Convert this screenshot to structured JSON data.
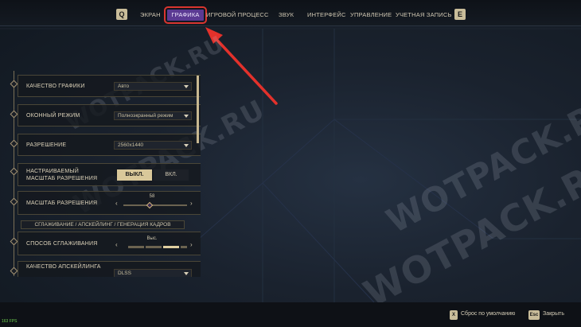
{
  "nav": {
    "left_key": "Q",
    "right_key": "E",
    "tabs": [
      {
        "label": "ЭКРАН"
      },
      {
        "label": "ГРАФИКА"
      },
      {
        "label": "ИГРОВОЙ ПРОЦЕСС"
      },
      {
        "label": "ЗВУК"
      },
      {
        "label": "ИНТЕРФЕЙС"
      },
      {
        "label": "УПРАВЛЕНИЕ"
      },
      {
        "label": "УЧЕТНАЯ ЗАПИСЬ"
      }
    ],
    "active_tab": "ГРАФИКА"
  },
  "settings": {
    "graphics_quality": {
      "label": "КАЧЕСТВО ГРАФИКИ",
      "value": "Авто"
    },
    "window_mode": {
      "label": "ОКОННЫЙ РЕЖИМ",
      "value": "Полноэкранный режим"
    },
    "resolution": {
      "label": "РАЗРЕШЕНИЕ",
      "value": "2560x1440"
    },
    "custom_scale": {
      "label_line1": "НАСТРАИВАЕМЫЙ",
      "label_line2": "МАСШТАБ РАЗРЕШЕНИЯ",
      "off_label": "ВЫКЛ.",
      "on_label": "ВКЛ."
    },
    "resolution_scale": {
      "label": "МАСШТАБ РАЗРЕШЕНИЯ",
      "value": "58"
    },
    "section_header": "СГЛАЖИВАНИЕ / АПСКЕЙЛИНГ / ГЕНЕРАЦИЯ КАДРОВ",
    "antialiasing": {
      "label": "СПОСОБ СГЛАЖИВАНИЯ",
      "value": "Выс."
    },
    "upscaling_quality": {
      "label": "КАЧЕСТВО АПСКЕЙЛИНГА",
      "value": "DLSS"
    }
  },
  "footer": {
    "reset_key": "X",
    "reset_label": "Сброс по умолчанию",
    "close_key": "Esc",
    "close_label": "Закрыть"
  },
  "fps": "163 FPS",
  "watermark": "WOTPACK.RU",
  "colors": {
    "accent_active_tab": "#5b3a93",
    "highlight": "#d9352f",
    "gold": "#c9bd9a"
  }
}
